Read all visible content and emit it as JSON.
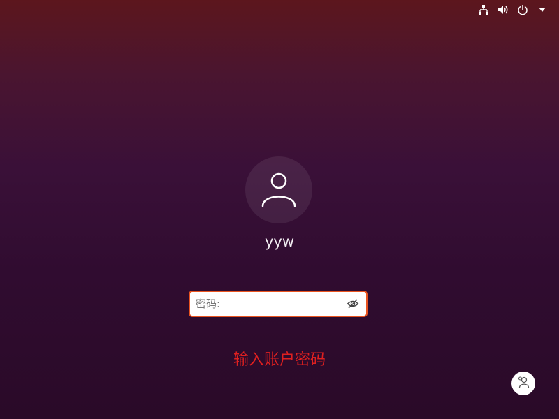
{
  "topbar": {
    "icons": [
      "network-icon",
      "volume-icon",
      "power-icon",
      "dropdown-arrow-icon"
    ]
  },
  "user": {
    "name": "yyw",
    "avatar_icon": "user-icon"
  },
  "password": {
    "placeholder": "密码:",
    "value": "",
    "reveal_icon": "eye-slash-icon"
  },
  "prompt": {
    "text": "输入账户密码"
  },
  "switch_user": {
    "icon": "switch-user-icon"
  },
  "colors": {
    "accent": "#e95420",
    "prompt_text": "#e02020",
    "background_top": "#5c161d",
    "background_bottom": "#2a0a28"
  }
}
